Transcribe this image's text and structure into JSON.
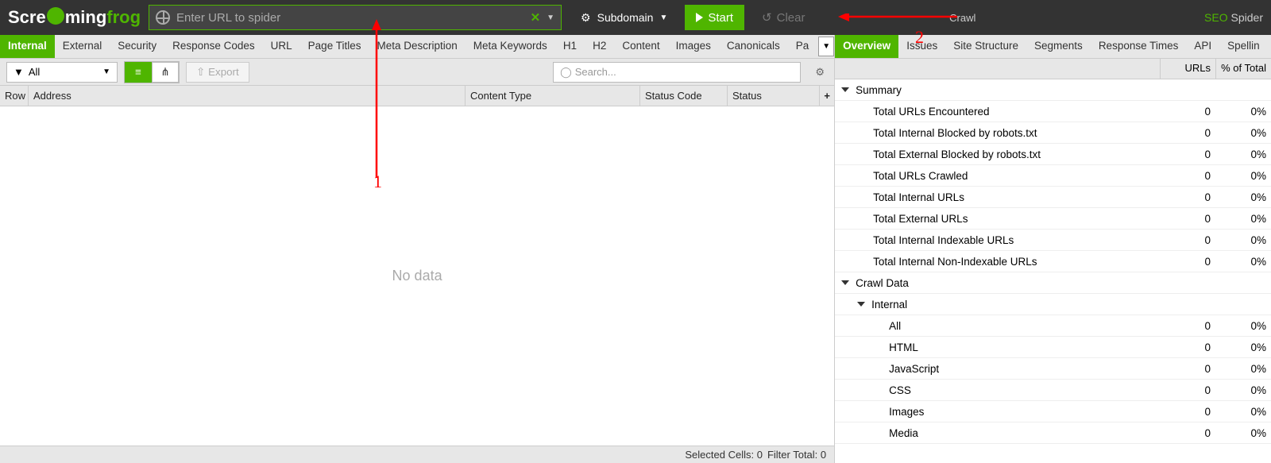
{
  "brand": {
    "part1": "Scre",
    "part2": "ming",
    "part3": "frog"
  },
  "url_placeholder": "Enter URL to spider",
  "mode_dropdown": "Subdomain",
  "btn_start": "Start",
  "btn_clear": "Clear",
  "crawl_label": "Crawl",
  "product": {
    "seo": "SEO",
    "spider": " Spider"
  },
  "left_tabs": [
    "Internal",
    "External",
    "Security",
    "Response Codes",
    "URL",
    "Page Titles",
    "Meta Description",
    "Meta Keywords",
    "H1",
    "H2",
    "Content",
    "Images",
    "Canonicals",
    "Pa"
  ],
  "filter_label": "All",
  "export_label": "Export",
  "search_placeholder": "Search...",
  "columns": {
    "row": "Row",
    "addr": "Address",
    "ct": "Content Type",
    "sc": "Status Code",
    "st": "Status"
  },
  "no_data": "No data",
  "status_cells": "Selected Cells:  0",
  "status_filter": "Filter Total:  0",
  "right_tabs": [
    "Overview",
    "Issues",
    "Site Structure",
    "Segments",
    "Response Times",
    "API",
    "Spellin"
  ],
  "right_cols": {
    "urls": "URLs",
    "pct": "% of Total"
  },
  "overview": [
    {
      "type": "section",
      "label": "Summary",
      "indent": 0,
      "caret": true
    },
    {
      "type": "row",
      "label": "Total URLs Encountered",
      "urls": "0",
      "pct": "0%",
      "indent": 2
    },
    {
      "type": "row",
      "label": "Total Internal Blocked by robots.txt",
      "urls": "0",
      "pct": "0%",
      "indent": 2
    },
    {
      "type": "row",
      "label": "Total External Blocked by robots.txt",
      "urls": "0",
      "pct": "0%",
      "indent": 2
    },
    {
      "type": "row",
      "label": "Total URLs Crawled",
      "urls": "0",
      "pct": "0%",
      "indent": 2
    },
    {
      "type": "row",
      "label": "Total Internal URLs",
      "urls": "0",
      "pct": "0%",
      "indent": 2
    },
    {
      "type": "row",
      "label": "Total External URLs",
      "urls": "0",
      "pct": "0%",
      "indent": 2
    },
    {
      "type": "row",
      "label": "Total Internal Indexable URLs",
      "urls": "0",
      "pct": "0%",
      "indent": 2
    },
    {
      "type": "row",
      "label": "Total Internal Non-Indexable URLs",
      "urls": "0",
      "pct": "0%",
      "indent": 2
    },
    {
      "type": "section",
      "label": "Crawl Data",
      "indent": 0,
      "caret": true
    },
    {
      "type": "section",
      "label": "Internal",
      "indent": 1,
      "caret": true
    },
    {
      "type": "row",
      "label": "All",
      "urls": "0",
      "pct": "0%",
      "indent": 3
    },
    {
      "type": "row",
      "label": "HTML",
      "urls": "0",
      "pct": "0%",
      "indent": 3
    },
    {
      "type": "row",
      "label": "JavaScript",
      "urls": "0",
      "pct": "0%",
      "indent": 3
    },
    {
      "type": "row",
      "label": "CSS",
      "urls": "0",
      "pct": "0%",
      "indent": 3
    },
    {
      "type": "row",
      "label": "Images",
      "urls": "0",
      "pct": "0%",
      "indent": 3
    },
    {
      "type": "row",
      "label": "Media",
      "urls": "0",
      "pct": "0%",
      "indent": 3
    }
  ],
  "annot": {
    "a1": "1",
    "a2": "2"
  }
}
